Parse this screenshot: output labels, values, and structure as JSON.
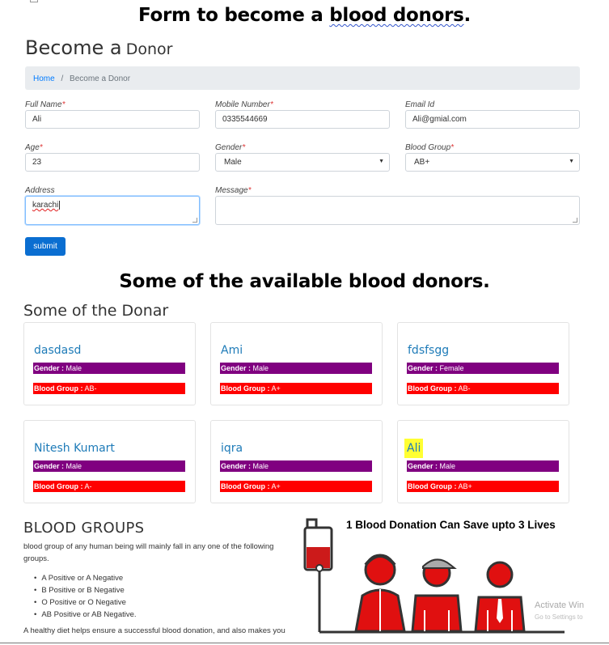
{
  "annotation": {
    "form_heading_pre": "Form to become a ",
    "form_heading_squiggle": "blood donors",
    "form_heading_post": ".",
    "list_heading": "Some of the available blood donors."
  },
  "page": {
    "title_big": "Become a",
    "title_small": "Donor"
  },
  "breadcrumb": {
    "home": "Home",
    "separator": "/",
    "current": "Become a Donor"
  },
  "form": {
    "full_name": {
      "label": "Full Name",
      "required": "*",
      "value": "Ali"
    },
    "mobile": {
      "label": "Mobile Number",
      "required": "*",
      "value": "0335544669"
    },
    "email": {
      "label": "Email Id",
      "value": "Ali@gmial.com"
    },
    "age": {
      "label": "Age",
      "required": "*",
      "value": "23"
    },
    "gender": {
      "label": "Gender",
      "required": "*",
      "value": "Male"
    },
    "blood_group": {
      "label": "Blood Group",
      "required": "*",
      "value": "AB+"
    },
    "address": {
      "label": "Address",
      "value": "karachi"
    },
    "message": {
      "label": "Message",
      "required": "*",
      "value": ""
    },
    "submit_label": "submit",
    "caret": "▼"
  },
  "donors": {
    "title": "Some of the Donar",
    "gender_prefix": "Gender :",
    "blood_prefix": "Blood Group :",
    "items": [
      {
        "name": "dasdasd",
        "gender": "Male",
        "blood": "AB-"
      },
      {
        "name": "Ami",
        "gender": "Male",
        "blood": "A+"
      },
      {
        "name": "fdsfsgg",
        "gender": "Female",
        "blood": "AB-"
      },
      {
        "name": "Nitesh Kumart",
        "gender": "Male",
        "blood": "A-"
      },
      {
        "name": "iqra",
        "gender": "Male",
        "blood": "A+"
      },
      {
        "name": "Ali",
        "gender": "Male",
        "blood": "AB+"
      }
    ]
  },
  "blood_groups": {
    "title": "BLOOD GROUPS",
    "description": "blood group of any human being will mainly fall in any one of the following groups.",
    "list": [
      "A Positive or A Negative",
      "B Positive or B Negative",
      "O Positive or O Negative",
      "AB Positive or AB Negative."
    ],
    "footer": "A healthy diet helps ensure a successful blood donation, and also makes you"
  },
  "illustration": {
    "caption": "1 Blood Donation Can Save upto 3 Lives"
  },
  "watermark": {
    "title": "Activate Win",
    "subtitle": "Go to Settings to"
  },
  "colors": {
    "accent": "#007bff",
    "button": "#0a6ed1",
    "gender_bar": "#800080",
    "blood_bar": "#ff0000",
    "donor_name": "#1e7bb8",
    "highlight": "#ffff33"
  }
}
